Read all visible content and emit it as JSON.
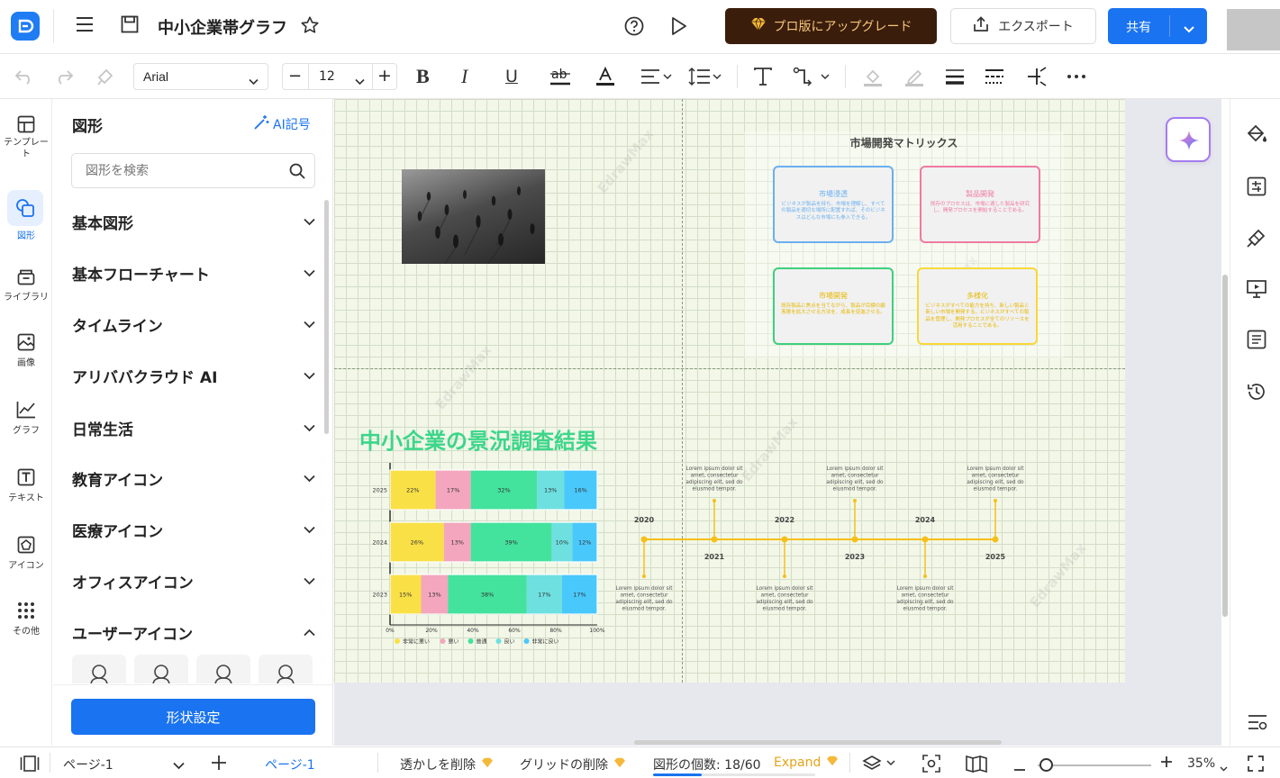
{
  "header": {
    "doc_title": "中小企業帯グラフ",
    "upgrade_label": "プロ版にアップグレード",
    "export_label": "エクスポート",
    "share_label": "共有"
  },
  "toolbar": {
    "font_family": "Arial",
    "font_size": "12",
    "decrease_label": "−",
    "increase_label": "+"
  },
  "rail": [
    {
      "id": "template",
      "label": "テンプレート"
    },
    {
      "id": "shapes",
      "label": "図形"
    },
    {
      "id": "library",
      "label": "ライブラリ"
    },
    {
      "id": "image",
      "label": "画像"
    },
    {
      "id": "graph",
      "label": "グラフ"
    },
    {
      "id": "text",
      "label": "テキスト"
    },
    {
      "id": "icon",
      "label": "アイコン"
    },
    {
      "id": "other",
      "label": "その他"
    }
  ],
  "panel": {
    "title": "図形",
    "ai_label": "AI記号",
    "search_placeholder": "図形を検索",
    "categories": [
      "基本図形",
      "基本フローチャート",
      "タイムライン",
      "アリババクラウド AI",
      "日常生活",
      "教育アイコン",
      "医療アイコン",
      "オフィスアイコン",
      "ユーザーアイコン"
    ],
    "settings_button": "形状設定"
  },
  "canvas": {
    "matrix": {
      "title": "市場開発マトリックス",
      "cards": [
        {
          "title": "市場浸透",
          "body": "ビジネスが製品を持ち、市場を理解し、すべての製品を適切な場所に配置すれば、そのビジネスはどんな市場にも参入できる。",
          "color": "#6ab0f0"
        },
        {
          "title": "製品開発",
          "body": "既存のプロセスは、市場に適した製品を研究し、開発プロセスを開始することである。",
          "color": "#f07aa0"
        },
        {
          "title": "市場開発",
          "body": "既存製品に焦点を当てながら、製品が目標の顧客層を拡大させる方法を、成長を促進させる。",
          "color": "#3ed07d"
        },
        {
          "title": "多様化",
          "body": "ビジネスがすべての能力を持ち、新しい製品と新しい市場を開発する。ビジネスがすべての製品を管理し、開発プロセスが全てのリソースを活用することである。",
          "color": "#f8d838"
        }
      ]
    },
    "survey_title": "中小企業の景況調査結果",
    "chart_data": {
      "type": "bar",
      "orientation": "horizontal-stacked-100",
      "categories": [
        "2025",
        "2024",
        "2023"
      ],
      "series": [
        {
          "name": "非常に悪い",
          "values": [
            22,
            26,
            15
          ],
          "color": "#f9e046"
        },
        {
          "name": "悪い",
          "values": [
            17,
            13,
            13
          ],
          "color": "#f3a6bd"
        },
        {
          "name": "普通",
          "values": [
            32,
            39,
            38
          ],
          "color": "#43e29d"
        },
        {
          "name": "良い",
          "values": [
            13,
            10,
            17
          ],
          "color": "#6ee0e0"
        },
        {
          "name": "非常に良い",
          "values": [
            16,
            12,
            17
          ],
          "color": "#49c8fc"
        }
      ],
      "data_labels": [
        [
          "22%",
          "17%",
          "32%",
          "13%",
          "16%"
        ],
        [
          "26%",
          "13%",
          "39%",
          "10%",
          "12%"
        ],
        [
          "15%",
          "13%",
          "38%",
          "17%",
          "17%"
        ]
      ],
      "xticks": [
        "0%",
        "20%",
        "40%",
        "60%",
        "80%",
        "100%"
      ],
      "xlim": [
        0,
        100
      ],
      "legend_placement": "bottom"
    },
    "timeline": {
      "years_top": [
        "2020",
        "2022",
        "2024"
      ],
      "years_bottom": [
        "2021",
        "2023",
        "2025"
      ],
      "note": "Lorem ipsum dolor sit amet, consectetur adipiscing elit, sed do eiusmod tempor.",
      "line_color": "#f5c01a"
    },
    "watermark": "EdrawMax"
  },
  "status": {
    "page_select": "ページ-1",
    "page_tab": "ページ-1",
    "remove_watermark": "透かしを削除",
    "remove_grid": "グリッドの削除",
    "shape_count": "図形の個数: 18/60",
    "expand": "Expand",
    "zoom": "35%"
  }
}
